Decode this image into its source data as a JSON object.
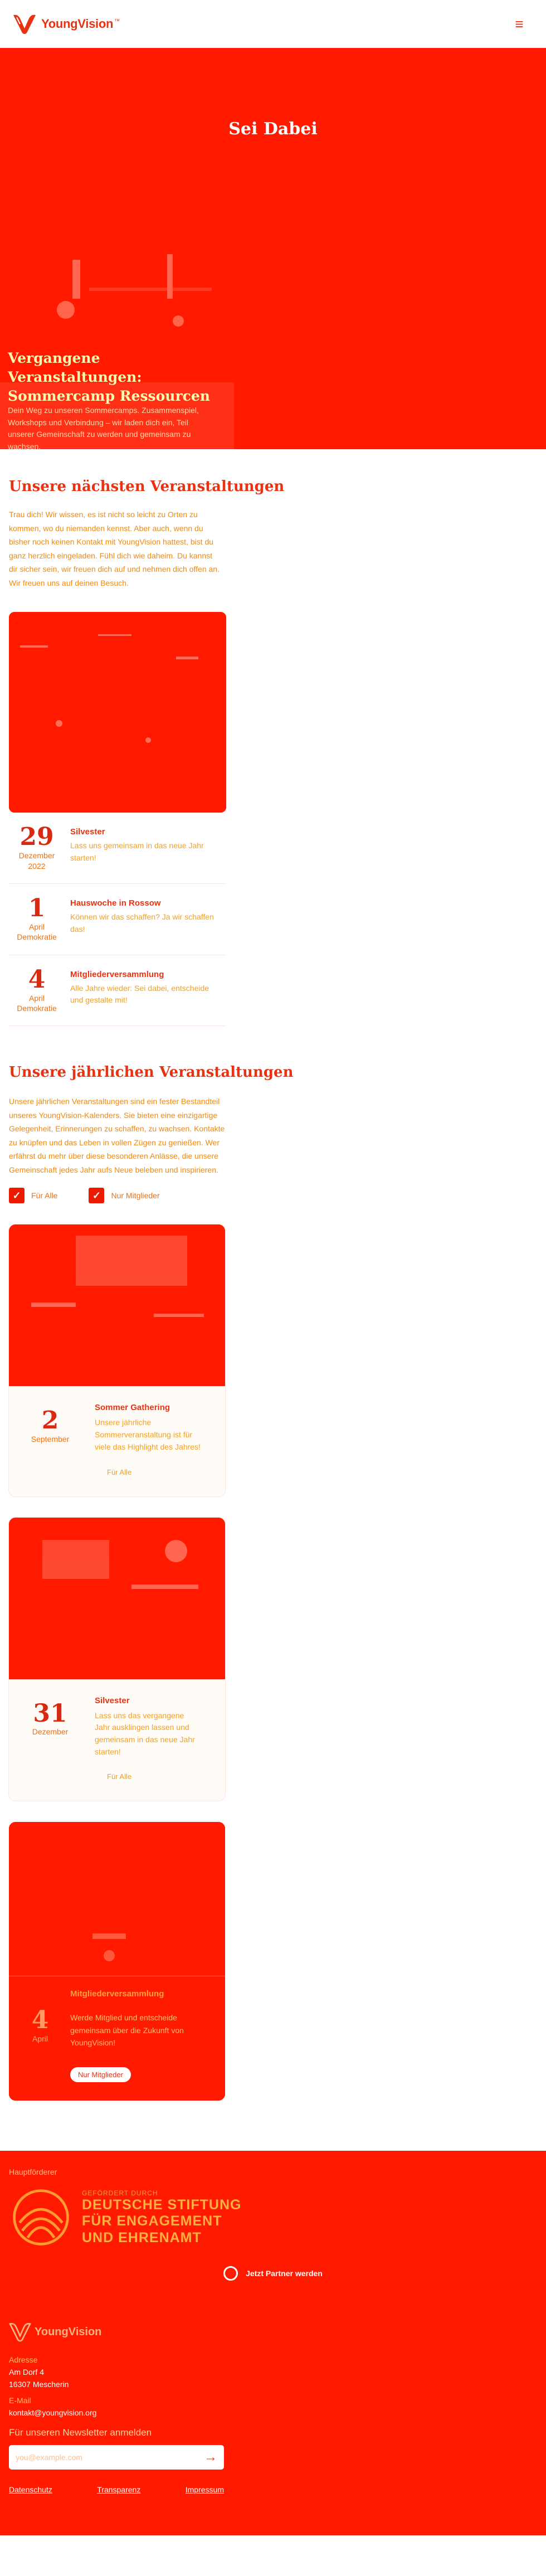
{
  "header": {
    "logo_text": "YoungVision",
    "logo_tm": "™",
    "menu_icon": "hamburger-icon"
  },
  "hero": {
    "title": "Sei Dabei",
    "subtitle": "Vergangene Veranstaltungen: Sommercamp Ressourcen",
    "text": "Dein Weg zu unseren Sommercamps. Zusammenspiel, Workshops und Verbindung – wir laden dich ein, Teil unserer Gemeinschaft zu werden und gemeinsam zu wachsen."
  },
  "next_events": {
    "heading": "Unsere nächsten Veranstaltungen",
    "text": "Trau dich! Wir wissen, es ist nicht so leicht zu Orten zu kommen, wo du niemanden kennst. Aber auch, wenn du bisher noch keinen Kontakt mit YoungVision hattest, bist du ganz herzlich eingeladen. Fühl dich wie daheim. Du kannst dir sicher sein, wir freuen dich auf und nehmen dich offen an. Wir freuen uns auf deinen Besuch."
  },
  "events": [
    {
      "day": "29",
      "month": "Dezember",
      "year": "2022",
      "title": "Silvester",
      "desc": "Lass uns gemeinsam in das neue Jahr starten!"
    },
    {
      "day": "1",
      "month": "April",
      "year": "Demokratie",
      "title": "Hauswoche in Rossow",
      "desc": "Können wir das schaffen? Ja wir schaffen das!"
    },
    {
      "day": "4",
      "month": "April",
      "year": "Demokratie",
      "title": "Mitgliederversammlung",
      "desc": "Alle Jahre wieder: Sei dabei, entscheide und gestalte mit!"
    }
  ],
  "annual": {
    "heading": "Unsere jährlichen Veranstaltungen",
    "text": "Unsere jährlichen Veranstaltungen sind ein fester Bestandteil unseres YoungVision-Kalenders. Sie bieten eine einzigartige Gelegenheit, Erinnerungen zu schaffen, zu wachsen. Kontakte zu knüpfen und das Leben in vollen Zügen zu genießen. Wer erfährst du mehr über diese besonderen Anlässe, die unsere Gemeinschaft jedes Jahr aufs Neue beleben und inspirieren.",
    "filter_all": "Für Alle",
    "filter_members": "Nur Mitglieder"
  },
  "annual_events": [
    {
      "day": "2",
      "month": "September",
      "title": "Sommer Gathering",
      "desc": "Unsere jährliche Sommerveranstaltung ist für viele das Highlight des Jahres!",
      "tag": "Für Alle"
    },
    {
      "day": "31",
      "month": "Dezember",
      "title": "Silvester",
      "desc": "Lass uns das vergangene Jahr ausklingen lassen und gemeinsam in das neue Jahr starten!",
      "tag": "Für Alle"
    }
  ],
  "member_event": {
    "day": "4",
    "month": "April",
    "title": "Mitgliederversammlung",
    "desc": "Werde Mitglied und entscheide gemeinsam über die Zukunft von YoungVision!",
    "cta": "Nur Mitglieder"
  },
  "footer": {
    "sponsor_label": "Hauptförderer",
    "dsee_small": "GEFÖRDERT DURCH",
    "dsee_line1": "DEUTSCHE STIFTUNG",
    "dsee_line2": "FÜR ENGAGEMENT",
    "dsee_line3": "UND EHRENAMT",
    "partner": "Jetzt Partner werden",
    "logo_text": "YoungVision",
    "address_label": "Adresse",
    "address_line1": "Am Dorf 4",
    "address_line2": "16307 Mescherin",
    "email_label": "E-Mail",
    "email": "kontakt@youngvision.org",
    "newsletter_label": "Für unseren Newsletter anmelden",
    "newsletter_placeholder": "you@example.com",
    "legal": [
      "Datenschutz",
      "Transparenz",
      "Impressum"
    ]
  },
  "colors": {
    "brand": "#e83312",
    "hero_bg": "#ff1a00"
  }
}
